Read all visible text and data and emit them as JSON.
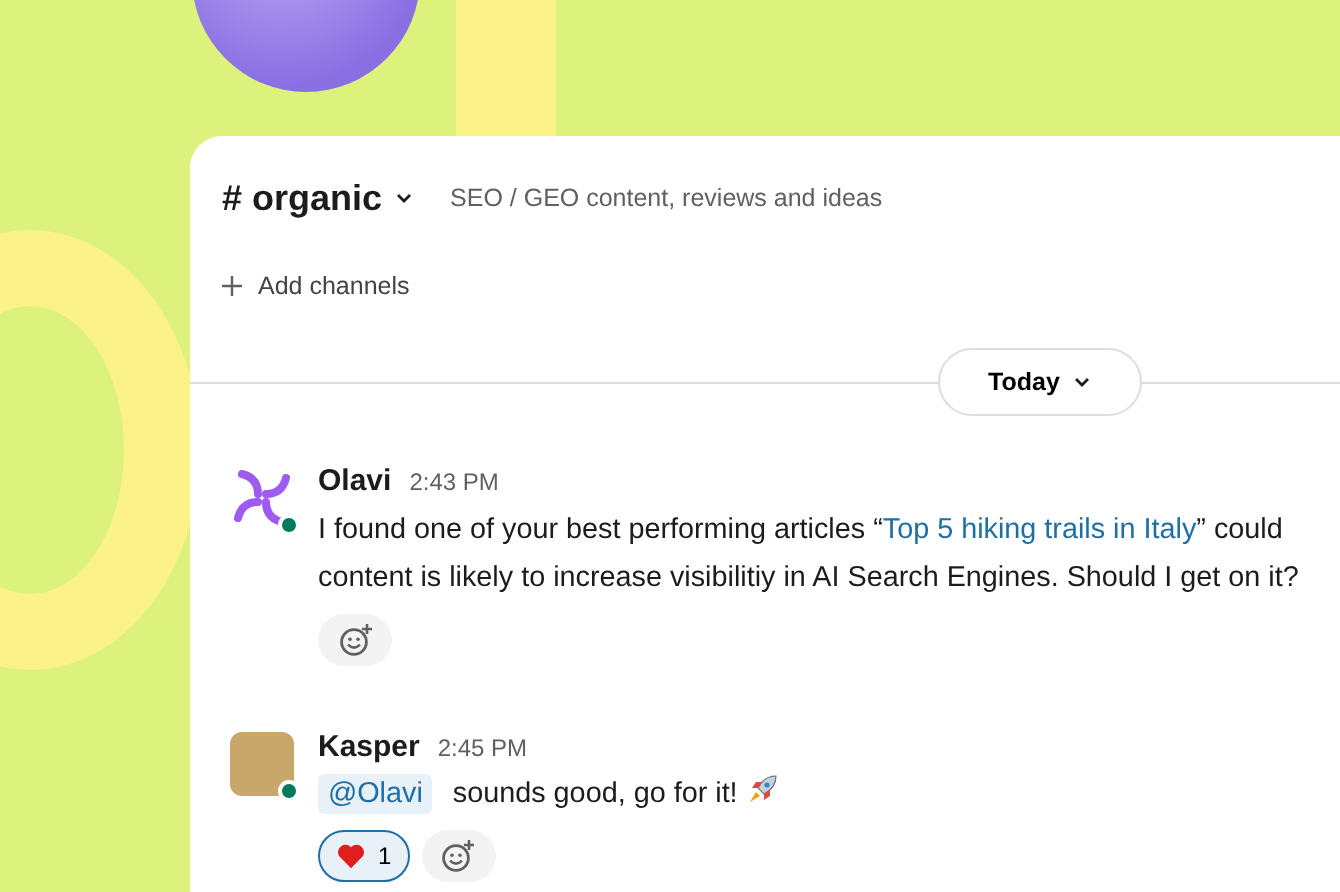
{
  "channel": {
    "name": "# organic",
    "topic": "SEO / GEO content, reviews and ideas",
    "add_channels": "Add channels"
  },
  "date_divider": {
    "label": "Today"
  },
  "messages": [
    {
      "author": "Olavi",
      "time": "2:43 PM",
      "kind": "logo",
      "online": true,
      "lines": [
        [
          {
            "kind": "text",
            "text": "I found one of your best performing articles “"
          },
          {
            "kind": "link",
            "text": "Top 5 hiking trails in Italy"
          },
          {
            "kind": "text",
            "text": "” could"
          }
        ],
        [
          {
            "kind": "text",
            "text": "content is likely to increase visibilitiy in AI Search Engines. Should I get on it?"
          }
        ]
      ]
    },
    {
      "author": "Kasper",
      "time": "2:45 PM",
      "kind": "photo",
      "online": true,
      "lines": [
        [
          {
            "kind": "mention",
            "text": "@Olavi"
          },
          {
            "kind": "text",
            "text": "sounds good, go for it!"
          },
          {
            "kind": "rocket"
          }
        ]
      ],
      "reactions": [
        {
          "kind": "heart",
          "count": "1",
          "selected": true
        }
      ]
    }
  ]
}
